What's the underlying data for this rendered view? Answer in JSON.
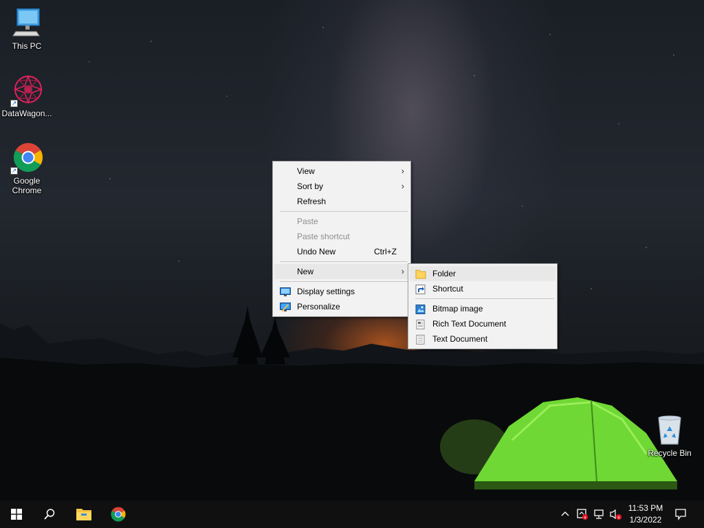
{
  "desktop": {
    "icons": [
      {
        "label": "This PC",
        "icon": "this-pc-icon"
      },
      {
        "label": "DataWagon...",
        "icon": "datawagon-icon"
      },
      {
        "label": "Google Chrome",
        "icon": "chrome-icon"
      },
      {
        "label": "Recycle Bin",
        "icon": "recycle-bin-icon"
      }
    ]
  },
  "context_menu": {
    "items": [
      {
        "label": "View",
        "has_submenu": true
      },
      {
        "label": "Sort by",
        "has_submenu": true
      },
      {
        "label": "Refresh"
      },
      {
        "label": "Paste",
        "disabled": true
      },
      {
        "label": "Paste shortcut",
        "disabled": true
      },
      {
        "label": "Undo New",
        "shortcut": "Ctrl+Z"
      },
      {
        "label": "New",
        "has_submenu": true,
        "highlighted": true
      },
      {
        "label": "Display settings",
        "icon": "display-settings-icon"
      },
      {
        "label": "Personalize",
        "icon": "personalize-icon"
      }
    ]
  },
  "new_submenu": {
    "items": [
      {
        "label": "Folder",
        "icon": "folder-icon",
        "highlighted": true
      },
      {
        "label": "Shortcut",
        "icon": "shortcut-icon"
      },
      {
        "label": "Bitmap image",
        "icon": "bitmap-icon"
      },
      {
        "label": "Rich Text Document",
        "icon": "rich-text-icon"
      },
      {
        "label": "Text Document",
        "icon": "text-document-icon"
      }
    ]
  },
  "taskbar": {
    "pinned": [
      "start-icon",
      "search-icon",
      "file-explorer-icon",
      "chrome-icon"
    ],
    "tray_icons": [
      "chevron-up-icon",
      "defender-icon",
      "network-icon",
      "volume-muted-icon"
    ],
    "time": "11:53 PM",
    "date": "1/3/2022",
    "notification_icon": "action-center-icon"
  },
  "colors": {
    "menu_bg": "#f2f2f2",
    "menu_highlight": "#e8e8e8",
    "taskbar_bg": "#101010",
    "tent_green": "#7be83a"
  }
}
